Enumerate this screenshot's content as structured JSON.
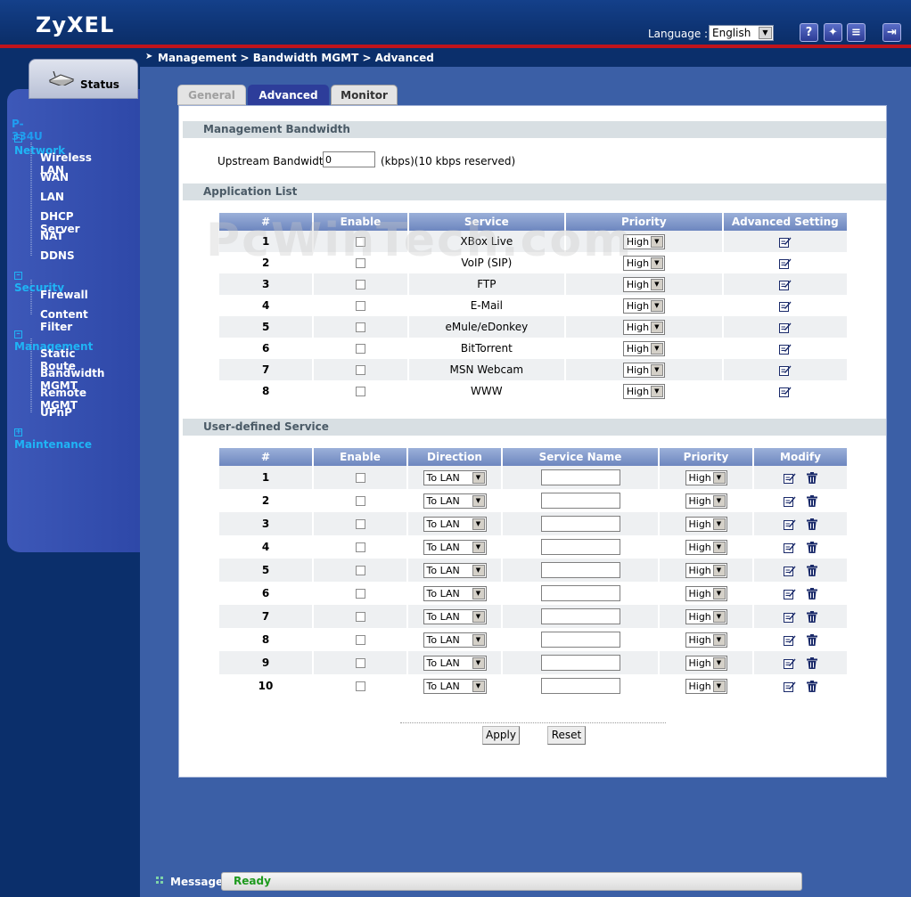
{
  "header": {
    "logo": "ZyXEL",
    "language_label": "Language :",
    "language_value": "English",
    "icons": [
      "help-icon",
      "wizard-icon",
      "notes-icon",
      "logout-icon"
    ]
  },
  "sidebar": {
    "status_label": "Status",
    "model": "P-334U",
    "groups": [
      {
        "label": "Network",
        "items": [
          "Wireless LAN",
          "WAN",
          "LAN",
          "DHCP Server",
          "NAT",
          "DDNS"
        ]
      },
      {
        "label": "Security",
        "items": [
          "Firewall",
          "Content Filter"
        ]
      },
      {
        "label": "Management",
        "items": [
          "Static Route",
          "Bandwidth MGMT",
          "Remote MGMT",
          "UPnP"
        ]
      },
      {
        "label": "Maintenance",
        "items": []
      }
    ]
  },
  "breadcrumb": "Management > Bandwidth MGMT > Advanced",
  "tabs": [
    {
      "label": "General",
      "state": "disabled"
    },
    {
      "label": "Advanced",
      "state": "active"
    },
    {
      "label": "Monitor",
      "state": "inactive"
    }
  ],
  "mgmt_bandwidth": {
    "title": "Management Bandwidth",
    "label": "Upstream Bandwidth",
    "value": "0",
    "unit": "(kbps)(10 kbps reserved)"
  },
  "app_list": {
    "title": "Application List",
    "columns": [
      "#",
      "Enable",
      "Service",
      "Priority",
      "Advanced Setting"
    ],
    "rows": [
      {
        "num": "1",
        "service": "XBox Live",
        "priority": "High"
      },
      {
        "num": "2",
        "service": "VoIP (SIP)",
        "priority": "High"
      },
      {
        "num": "3",
        "service": "FTP",
        "priority": "High"
      },
      {
        "num": "4",
        "service": "E-Mail",
        "priority": "High"
      },
      {
        "num": "5",
        "service": "eMule/eDonkey",
        "priority": "High"
      },
      {
        "num": "6",
        "service": "BitTorrent",
        "priority": "High"
      },
      {
        "num": "7",
        "service": "MSN Webcam",
        "priority": "High"
      },
      {
        "num": "8",
        "service": "WWW",
        "priority": "High"
      }
    ]
  },
  "user_defined": {
    "title": "User-defined Service",
    "columns": [
      "#",
      "Enable",
      "Direction",
      "Service Name",
      "Priority",
      "Modify"
    ],
    "rows": [
      {
        "num": "1",
        "direction": "To LAN",
        "priority": "High"
      },
      {
        "num": "2",
        "direction": "To LAN",
        "priority": "High"
      },
      {
        "num": "3",
        "direction": "To LAN",
        "priority": "High"
      },
      {
        "num": "4",
        "direction": "To LAN",
        "priority": "High"
      },
      {
        "num": "5",
        "direction": "To LAN",
        "priority": "High"
      },
      {
        "num": "6",
        "direction": "To LAN",
        "priority": "High"
      },
      {
        "num": "7",
        "direction": "To LAN",
        "priority": "High"
      },
      {
        "num": "8",
        "direction": "To LAN",
        "priority": "High"
      },
      {
        "num": "9",
        "direction": "To LAN",
        "priority": "High"
      },
      {
        "num": "10",
        "direction": "To LAN",
        "priority": "High"
      }
    ]
  },
  "buttons": {
    "apply": "Apply",
    "reset": "Reset"
  },
  "status": {
    "label": "Message",
    "text": "Ready"
  },
  "watermark": "PcWinTech.com",
  "colors": {
    "accent_red": "#c0141c",
    "nav_link": "#1fb4f5",
    "ready_green": "#1e9a1e"
  }
}
